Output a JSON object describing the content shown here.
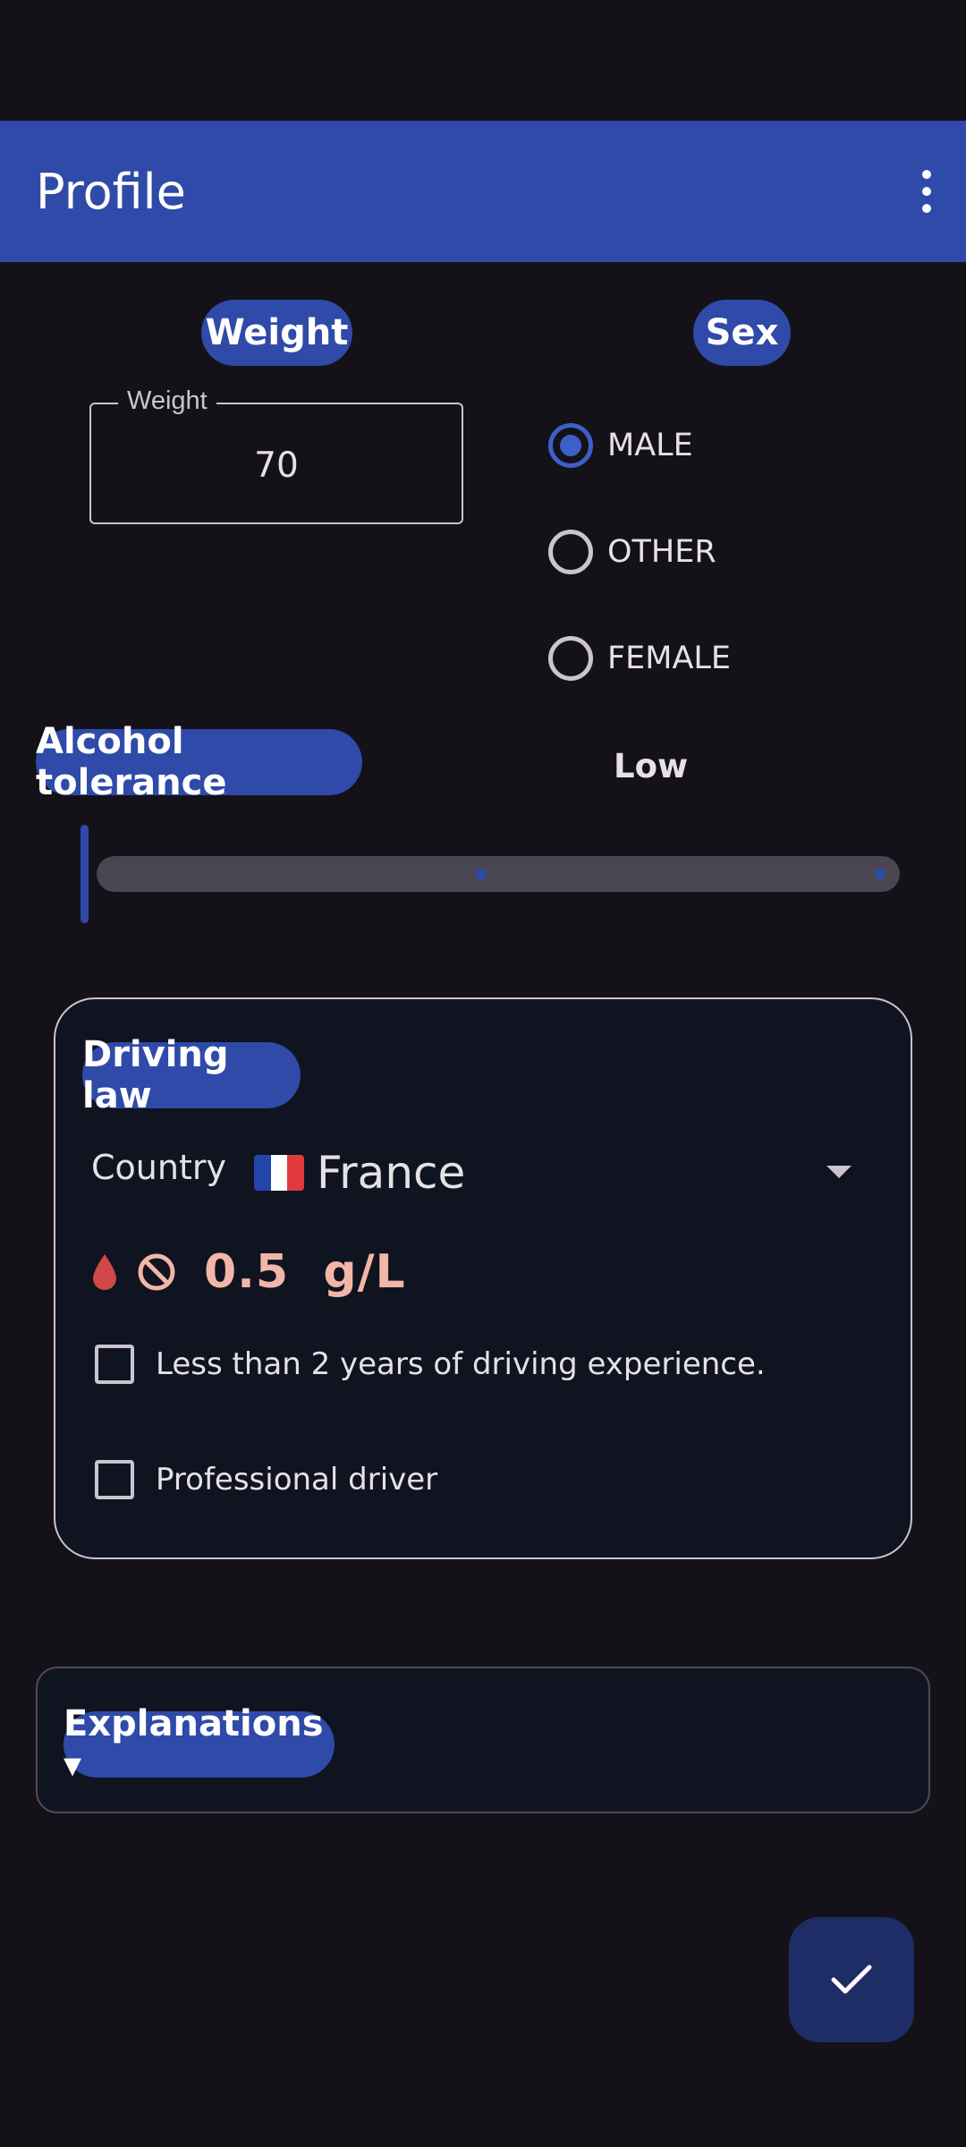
{
  "appbar": {
    "title": "Profile",
    "menu_icon": "more-vert-icon"
  },
  "weight": {
    "section_label": "Weight",
    "field_label": "Weight",
    "value": "70"
  },
  "sex": {
    "section_label": "Sex",
    "options": [
      {
        "label": "MALE",
        "selected": true
      },
      {
        "label": "OTHER",
        "selected": false
      },
      {
        "label": "FEMALE",
        "selected": false
      }
    ]
  },
  "tolerance": {
    "section_label": "Alcohol tolerance",
    "value_label": "Low",
    "slider_level": 0.0
  },
  "driving_law": {
    "section_label": "Driving law",
    "country_label": "Country",
    "country": "France",
    "country_flag": "flag-france-icon",
    "limit_value": "0.5",
    "limit_unit": "g/L",
    "checkboxes": [
      {
        "label": "Less than 2 years of driving experience.",
        "checked": false
      },
      {
        "label": "Professional driver",
        "checked": false
      }
    ]
  },
  "explanations": {
    "label": "Explanations ▾"
  },
  "fab": {
    "icon": "check-icon"
  },
  "colors": {
    "primary": "#2f4aa8",
    "background": "#141218",
    "card": "#101420",
    "limit_text": "#f2b6a8",
    "drop": "#d04848"
  }
}
